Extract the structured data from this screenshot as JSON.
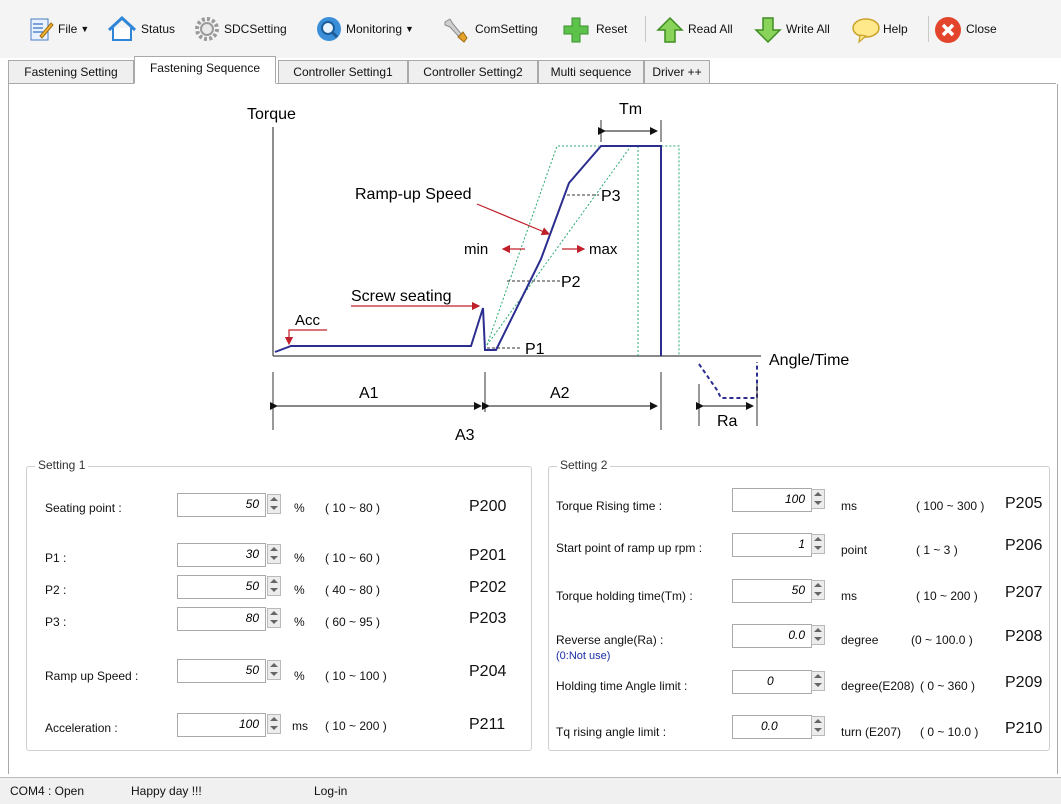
{
  "toolbar": {
    "file": "File",
    "status": "Status",
    "sdcsetting": "SDCSetting",
    "monitoring": "Monitoring",
    "comsetting": "ComSetting",
    "reset": "Reset",
    "read_all": "Read All",
    "write_all": "Write All",
    "help": "Help",
    "close": "Close"
  },
  "tabs": [
    {
      "label": "Fastening Setting"
    },
    {
      "label": "Fastening Sequence"
    },
    {
      "label": "Controller Setting1"
    },
    {
      "label": "Controller Setting2"
    },
    {
      "label": "Multi sequence"
    },
    {
      "label": "Driver ++"
    }
  ],
  "active_tab": "Fastening Sequence",
  "diagram": {
    "y_axis": "Torque",
    "x_axis": "Angle/Time",
    "tm": "Tm",
    "ramp_up_speed": "Ramp-up  Speed",
    "min": "min",
    "max": "max",
    "p1": "P1",
    "p2": "P2",
    "p3": "P3",
    "screw_seating": "Screw  seating",
    "acc": "Acc",
    "a1": "A1",
    "a2": "A2",
    "a3": "A3",
    "ra": "Ra"
  },
  "setting1": {
    "title": "Setting 1",
    "rows": [
      {
        "label": "Seating point :",
        "value": "50",
        "unit": "%",
        "range": "( 10 ~ 80 )",
        "code": "P200"
      },
      {
        "label": "P1 :",
        "value": "30",
        "unit": "%",
        "range": "( 10 ~ 60 )",
        "code": "P201"
      },
      {
        "label": "P2 :",
        "value": "50",
        "unit": "%",
        "range": "( 40 ~ 80 )",
        "code": "P202"
      },
      {
        "label": "P3 :",
        "value": "80",
        "unit": "%",
        "range": "( 60 ~ 95 )",
        "code": "P203"
      },
      {
        "label": "Ramp up Speed :",
        "value": "50",
        "unit": "%",
        "range": "( 10 ~ 100 )",
        "code": "P204"
      },
      {
        "label": "Acceleration :",
        "value": "100",
        "unit": "ms",
        "range": "( 10 ~ 200 )",
        "code": "P211"
      }
    ]
  },
  "setting2": {
    "title": "Setting 2",
    "reverse_note": "(0:Not use)",
    "rows": [
      {
        "label": "Torque Rising time :",
        "value": "100",
        "unit": "ms",
        "range": "( 100 ~ 300 )",
        "code": "P205"
      },
      {
        "label": "Start point of ramp up rpm :",
        "value": "1",
        "unit": "point",
        "range": "( 1 ~ 3 )",
        "code": "P206"
      },
      {
        "label": "Torque holding time(Tm) :",
        "value": "50",
        "unit": "ms",
        "range": "( 10 ~ 200 )",
        "code": "P207"
      },
      {
        "label": "Reverse angle(Ra) :",
        "value": "0.0",
        "unit": "degree",
        "range": "(0 ~ 100.0 )",
        "code": "P208"
      },
      {
        "label": "Holding time Angle limit :",
        "value": "0",
        "unit": "degree(E208)",
        "range": "( 0 ~ 360 )",
        "code": "P209"
      },
      {
        "label": "Tq rising angle limit :",
        "value": "0.0",
        "unit": "turn (E207)",
        "range": "( 0 ~ 10.0 )",
        "code": "P210"
      }
    ]
  },
  "statusbar": {
    "port": "COM4 : Open",
    "message": "Happy day !!!",
    "login": "Log-in"
  },
  "colors": {
    "curve": "#2b2e8f",
    "arrow": "#c0202a",
    "dotted": "#2aa86e",
    "accent_close": "#e2452b"
  }
}
